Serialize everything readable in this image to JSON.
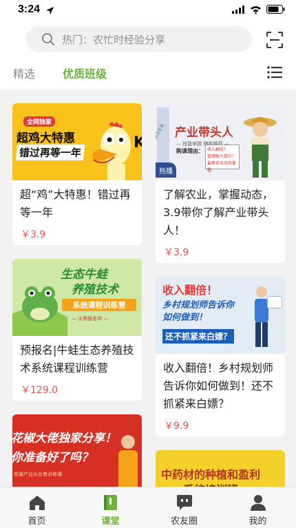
{
  "status_bar": {
    "time": "3:24"
  },
  "search": {
    "placeholder": "热门：农忙时经验分享"
  },
  "tabs": [
    {
      "label": "精选",
      "active": false
    },
    {
      "label": "优质班级",
      "active": true
    }
  ],
  "courses": [
    {
      "title": "超“鸡”大特惠！错过再等一年",
      "price": "￥3.9",
      "banner": {
        "tag": "全网独家",
        "line1": "超鸡大特惠",
        "line2": "错过再等一年",
        "corner": "K"
      }
    },
    {
      "title": "了解农业，掌握动态，3.9带你了解产业带头人！",
      "price": "￥3.9",
      "banner": {
        "side_text": "ONE LEADER",
        "title": "产业带头人",
        "sub": "— 技能掌握 赚款推荐 —",
        "box_title": "购课理由：",
        "box_lines": [
          "收入翻倍！",
          "管理能力提升！",
          "最新农业动态掌握"
        ],
        "badge": "热播"
      }
    },
    {
      "title": "预报名|牛蛙生态养殖技术系统课程训练营",
      "price": "￥129.0",
      "banner": {
        "line1": "生态牛蛙",
        "line2": "养殖技术",
        "ribbon": "系统课程训练营",
        "hot": "— 火热报名中 —"
      }
    },
    {
      "title": "收入翻倍！乡村规划师告诉你如何做到！还不抓紧来白嫖？",
      "price": "￥9.9",
      "banner": {
        "line1": "收入翻倍！",
        "line2": "乡村规划师告诉你",
        "line3": "如何做到！",
        "line4": "还不抓紧来白嫖？"
      }
    },
    {
      "banner": {
        "line1": "花椒大佬独家分享！",
        "line2": "你准备好了吗？",
        "small": "花椒产业从业者必修课"
      }
    },
    {
      "banner": {
        "line1": "中药材的种植和盈利",
        "line2": "系统培训班"
      }
    }
  ],
  "bottom_nav": [
    {
      "label": "首页",
      "icon": "home-icon",
      "active": false
    },
    {
      "label": "课堂",
      "icon": "classroom-icon",
      "active": true
    },
    {
      "label": "农友圈",
      "icon": "chat-icon",
      "active": false
    },
    {
      "label": "我的",
      "icon": "profile-icon",
      "active": false
    }
  ],
  "colors": {
    "accent": "#6ab23a",
    "price": "#e2524f",
    "background": "#f2f2f2"
  }
}
